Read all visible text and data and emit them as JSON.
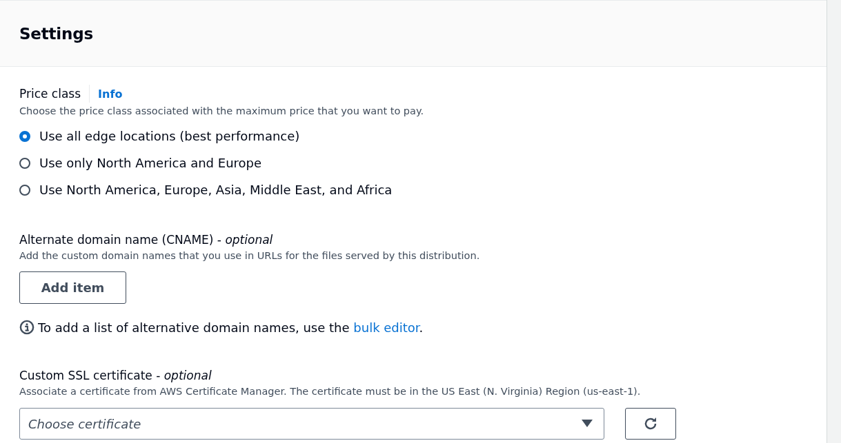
{
  "panel": {
    "title": "Settings"
  },
  "price_class": {
    "label": "Price class",
    "info_link": "Info",
    "description": "Choose the price class associated with the maximum price that you want to pay.",
    "options": [
      {
        "label": "Use all edge locations (best performance)",
        "selected": true
      },
      {
        "label": "Use only North America and Europe",
        "selected": false
      },
      {
        "label": "Use North America, Europe, Asia, Middle East, and Africa",
        "selected": false
      }
    ]
  },
  "alternate_domain": {
    "label": "Alternate domain name (CNAME) - *optional*",
    "description": "Add the custom domain names that you use in URLs for the files served by this distribution.",
    "add_button": "Add item",
    "note_before": "To add a list of alternative domain names, use the ",
    "note_link": "bulk editor",
    "note_after": "."
  },
  "ssl_certificate": {
    "label": "Custom SSL certificate - *optional*",
    "description": "Associate a certificate from AWS Certificate Manager. The certificate must be in the US East (N. Virginia) Region (us-east-1).",
    "select": {
      "placeholder": "Choose certificate"
    }
  }
}
